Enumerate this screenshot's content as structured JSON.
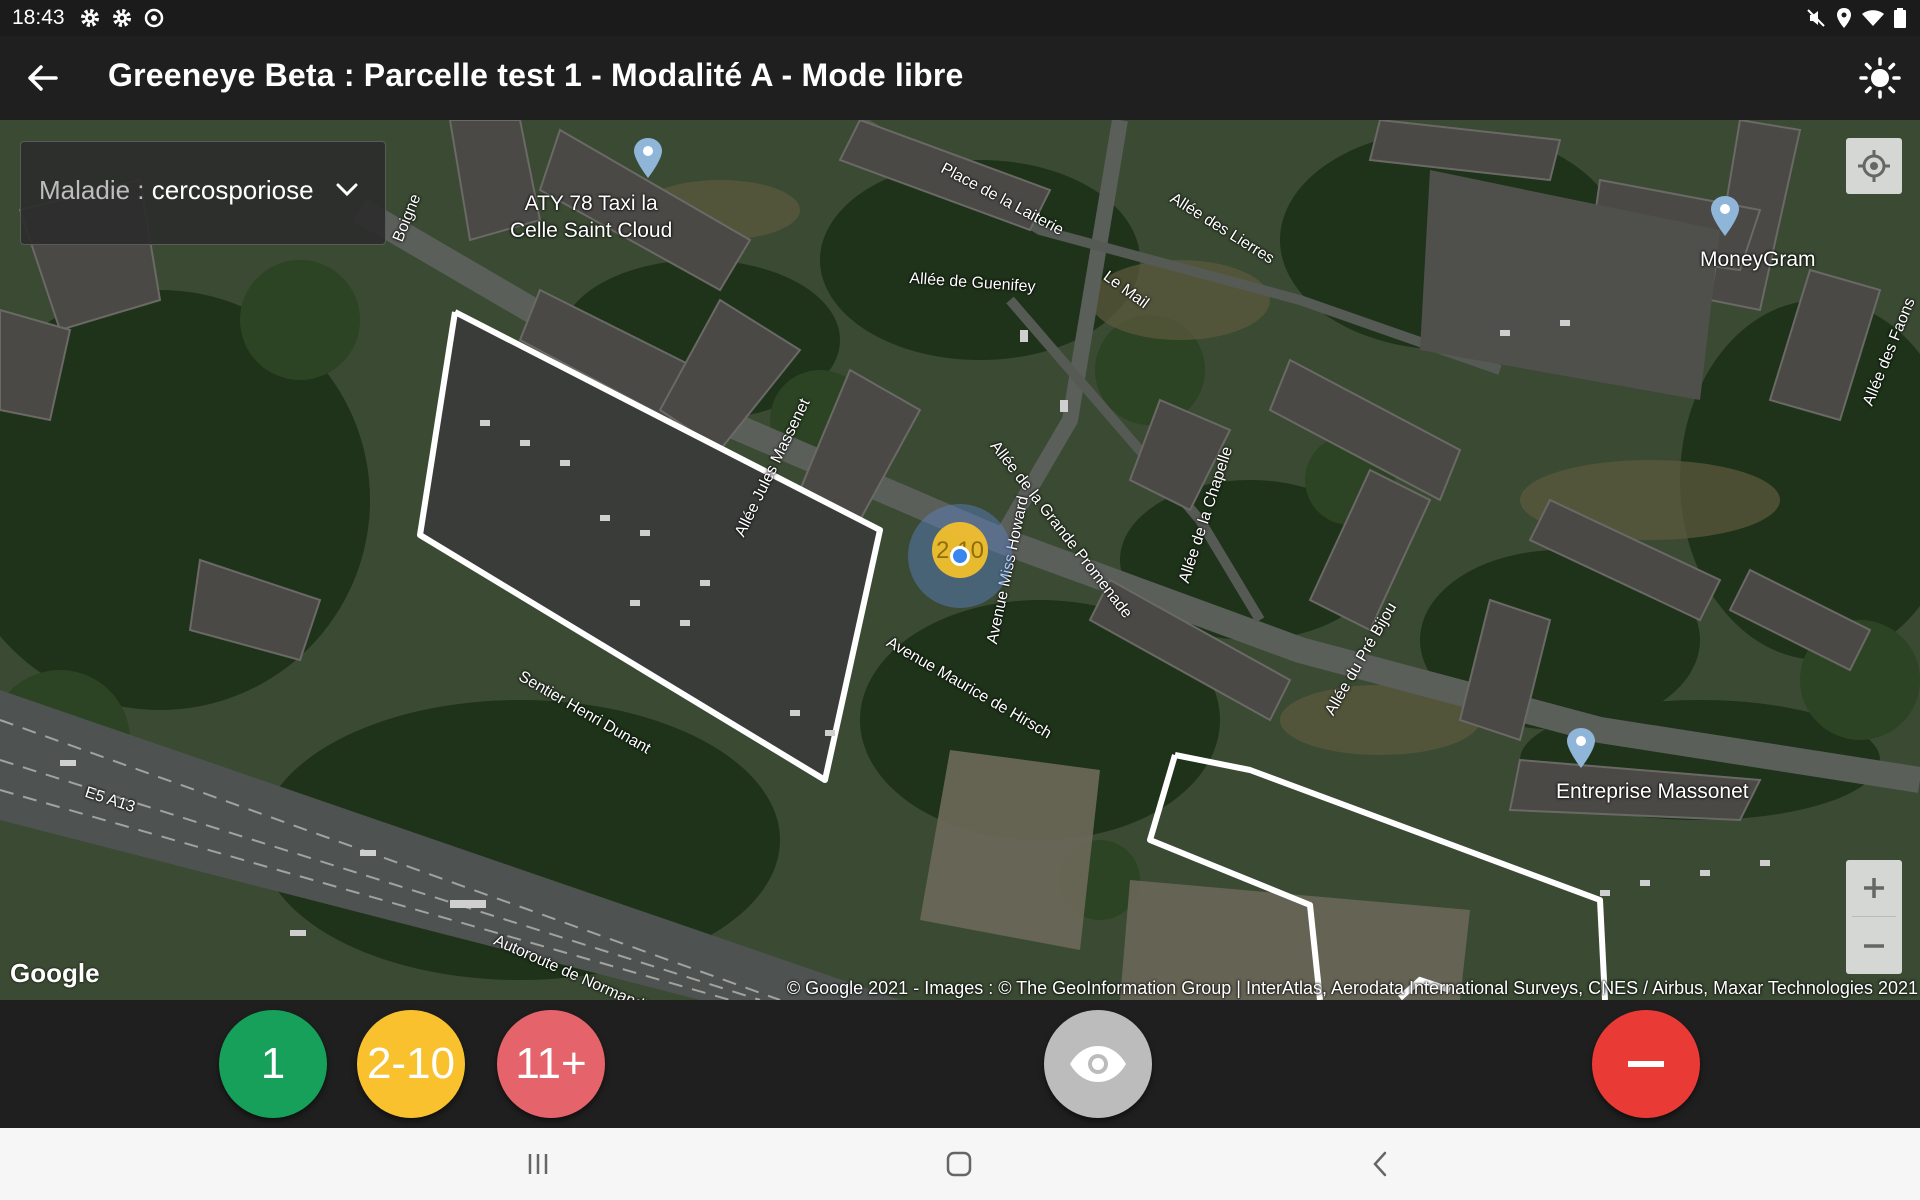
{
  "status_bar": {
    "time": "18:43",
    "left_icons": [
      "gear-icon",
      "gear-icon",
      "sync-icon"
    ],
    "right_icons": [
      "mute-icon",
      "location-icon",
      "wifi-icon",
      "battery-icon"
    ]
  },
  "app_bar": {
    "title": "Greeneye Beta : Parcelle test 1 - Modalité A - Mode libre",
    "back_icon": "arrow-left-icon",
    "theme_icon": "brightness-icon"
  },
  "disease_selector": {
    "label": "Maladie : ",
    "value": "cercosporiose"
  },
  "map": {
    "map_type": "satellite",
    "pois": [
      {
        "name": "ATY 78 Taxi la Celle Saint Cloud",
        "line1": "ATY 78 Taxi la",
        "line2": "Celle Saint Cloud"
      },
      {
        "name": "MoneyGram"
      },
      {
        "name": "Entreprise Massonet"
      }
    ],
    "street_labels": [
      "Place de la Laiterie",
      "Allée des Lierres",
      "Allée de Guenifey",
      "Le Mail",
      "Allée Jules Massenet",
      "Allée de la Grande Promenade",
      "Avenue Miss Howard",
      "Allée de la Chapelle",
      "Allée du Pré Bijou",
      "Avenue Maurice de Hirsch",
      "Sentier Henri Dunant",
      "E5 A13",
      "Autoroute de Normandie",
      "Allée des Faons",
      "Boigne"
    ],
    "marker_value": "2-10",
    "google_logo": "Google",
    "attribution": "© Google 2021 - Images : © The GeoInformation Group | InterAtlas, Aerodata International Surveys, CNES / Airbus, Maxar Technologies 2021",
    "zoom_in": "+",
    "zoom_out": "−"
  },
  "count_buttons": [
    {
      "label": "1",
      "color": "#16a05a"
    },
    {
      "label": "2-10",
      "color": "#f8c12d"
    },
    {
      "label": "11+",
      "color": "#e5646b"
    }
  ],
  "view_button_icon": "eye-icon",
  "remove_button_icon": "minus-icon",
  "nav_bar": [
    "recent-apps-icon",
    "home-icon",
    "back-icon"
  ]
}
